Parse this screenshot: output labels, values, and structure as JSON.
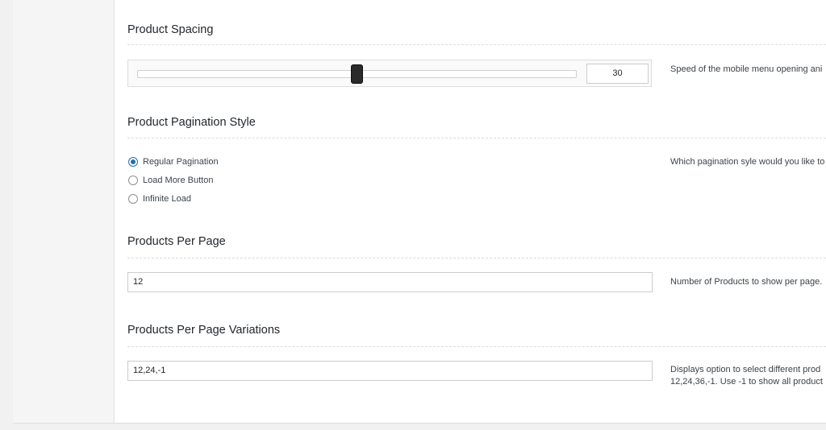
{
  "sections": {
    "spacing": {
      "title": "Product Spacing",
      "slider_value": "30",
      "slider_fraction": 0.5,
      "description": "Speed of the mobile menu opening ani"
    },
    "pagination": {
      "title": "Product Pagination Style",
      "options": [
        {
          "label": "Regular Pagination",
          "checked": true
        },
        {
          "label": "Load More Button",
          "checked": false
        },
        {
          "label": "Infinite Load",
          "checked": false
        }
      ],
      "description": "Which pagination syle would you like to"
    },
    "per_page": {
      "title": "Products Per Page",
      "value": "12",
      "description": "Number of Products to show per page."
    },
    "per_page_variations": {
      "title": "Products Per Page Variations",
      "value": "12,24,-1",
      "description_line1": "Displays option to select different prod",
      "description_line2": "12,24,36,-1. Use -1 to show all product"
    }
  },
  "colors": {
    "accent": "#2271b1",
    "panel_bg": "#ffffff",
    "page_bg": "#f1f1f1"
  }
}
